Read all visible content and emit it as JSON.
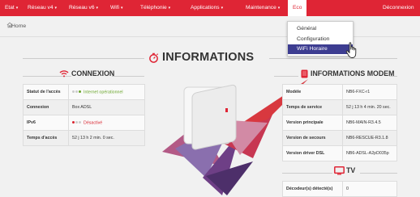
{
  "navbar": {
    "items": [
      {
        "label": "Etat"
      },
      {
        "label": "Réseau v4"
      },
      {
        "label": "Réseau v6"
      },
      {
        "label": "Wifi"
      },
      {
        "label": "Téléphonie"
      },
      {
        "label": "Applications"
      },
      {
        "label": "Maintenance"
      },
      {
        "label": "Eco"
      }
    ],
    "logout_label": "Déconnexion",
    "brand_color": "#df2535"
  },
  "breadcrumb": {
    "home_label": "Home"
  },
  "dropdown": {
    "items": [
      "Général",
      "Configuration",
      "WiFi Horaire"
    ],
    "selected": "WiFi Horaire"
  },
  "page": {
    "title": "INFORMATIONS"
  },
  "connexion": {
    "title": "CONNEXION",
    "rows": [
      {
        "key": "Statut de l'accès",
        "value": "Internet opérationnel",
        "status": "green"
      },
      {
        "key": "Connexion",
        "value": "Box ADSL"
      },
      {
        "key": "IPv6",
        "value": "Désactivé",
        "status": "red"
      },
      {
        "key": "Temps d'accès",
        "value": "52 j 13 h 2 min. 0 sec."
      }
    ]
  },
  "modem": {
    "title": "INFORMATIONS MODEM",
    "rows": [
      {
        "key": "Modèle",
        "value": "NB6-FXC-r1"
      },
      {
        "key": "Temps de service",
        "value": "52 j 13 h 4 min. 20 sec."
      },
      {
        "key": "Version principale",
        "value": "NB6-MAIN-R3.4.5"
      },
      {
        "key": "Version de secours",
        "value": "NB6-RESCUE-R3.1.8"
      },
      {
        "key": "Version driver DSL",
        "value": "NB6-ADSL-A2pD035p"
      }
    ]
  },
  "tv": {
    "title": "TV",
    "rows": [
      {
        "key": "Décodeur(s) détecté(s)",
        "value": "0"
      }
    ]
  }
}
